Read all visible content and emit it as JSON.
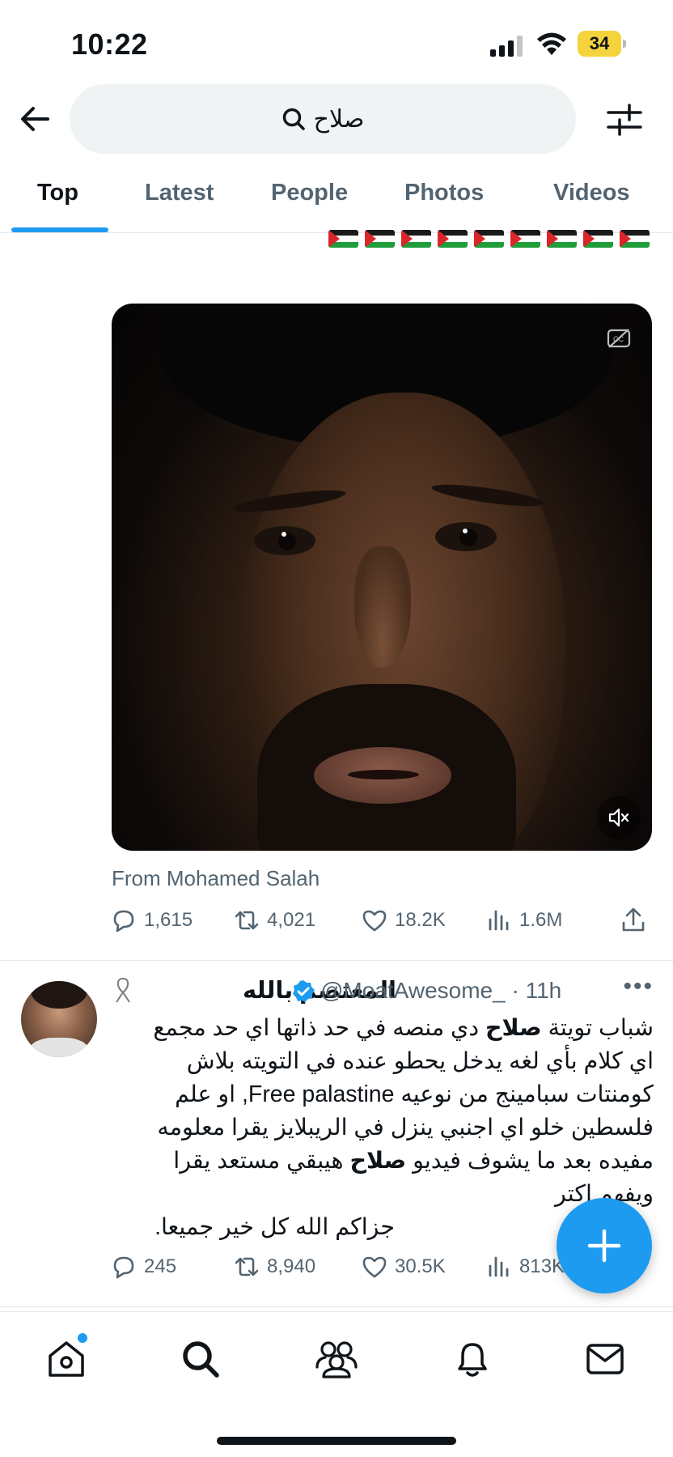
{
  "status_bar": {
    "time": "10:22",
    "battery": "34"
  },
  "search": {
    "query": "صلاح"
  },
  "tabs": [
    {
      "label": "Top",
      "active": true
    },
    {
      "label": "Latest",
      "active": false
    },
    {
      "label": "People",
      "active": false
    },
    {
      "label": "Photos",
      "active": false
    },
    {
      "label": "Videos",
      "active": false
    }
  ],
  "tweet1": {
    "flag_count": 9,
    "video_source": "From Mohamed Salah",
    "stats": {
      "replies": "1,615",
      "reposts": "4,021",
      "likes": "18.2K",
      "views": "1.6M"
    }
  },
  "tweet2": {
    "name": "المعتصم بالله",
    "handle": "@MoatAwesome_",
    "time": "· 11h",
    "body": {
      "line1_a": "شباب تويتة",
      "line1_b": "صلاح",
      "line1_c": "دي منصه في حد ذاتها اي حد مجمع",
      "line2": "اي كلام بأي لغه يدخل يحطو عنده في التويته بلاش",
      "line3": "كومنتات سبامينج من نوعيه Free palastine, او علم",
      "line4": "فلسطين خلو اي اجنبي ينزل في الريبلايز يقرا معلومه",
      "line5_a": "مفيده بعد ما يشوف فيديو",
      "line5_b": "صلاح",
      "line5_c": "هيبقي مستعد يقرا",
      "line6": "ويفهم اكتر",
      "line7": "جزاكم الله كل خير جميعا."
    },
    "stats": {
      "replies": "245",
      "reposts": "8,940",
      "likes": "30.5K",
      "views": "813K"
    }
  },
  "colors": {
    "accent": "#1d9bf0",
    "text_primary": "#0f1419",
    "text_secondary": "#536471",
    "search_bg": "#eff3f4"
  },
  "icons": {
    "status": [
      "signal-icon",
      "wifi-icon",
      "battery-icon"
    ],
    "header": [
      "back-arrow-icon",
      "search-icon",
      "filter-sliders-icon"
    ],
    "actions": [
      "reply-icon",
      "repost-icon",
      "like-icon",
      "views-icon",
      "share-icon"
    ],
    "bottom_nav": [
      "home-icon",
      "search-icon",
      "communities-icon",
      "notifications-icon",
      "messages-icon"
    ],
    "fab": "plus-icon"
  }
}
